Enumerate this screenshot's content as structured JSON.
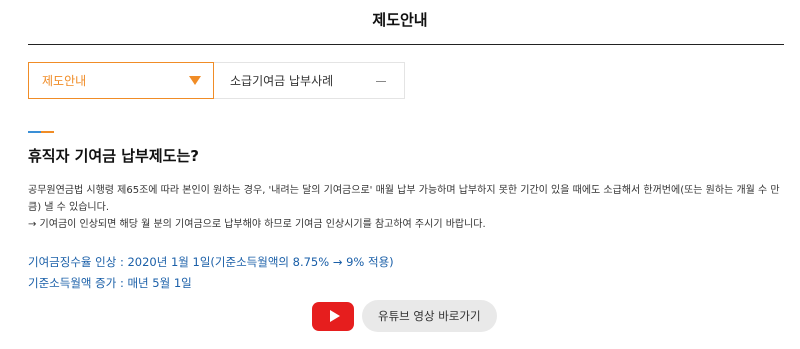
{
  "page": {
    "title": "제도안내"
  },
  "menu": {
    "dropdown_label": "제도안내",
    "tab_label": "소급기여금 납부사례"
  },
  "section": {
    "heading": "휴직자 기여금 납부제도는?",
    "paragraph1": "공무원연금법 시행령 제65조에 따라 본인이 원하는 경우, '내려는 달의 기여금으로' 매월 납부 가능하며 납부하지 못한 기간이 있을 때에도 소급해서 한꺼번에(또는 원하는 개월 수 만큼) 낼 수 있습니다.",
    "paragraph2": "→ 기여금이 인상되면 해당 월 분의 기여금으로 납부해야 하므로 기여금 인상시기를 참고하여 주시기 바랍니다.",
    "highlight1": "기여금징수율 인상 : 2020년 1월 1일(기준소득월액의 8.75% → 9% 적용)",
    "highlight2": "기준소득월액 증가 : 매년 5월 1일"
  },
  "youtube": {
    "button_label": "유튜브 영상 바로가기"
  },
  "colors": {
    "accent_orange": "#f08c26",
    "link_blue": "#1a5fa8",
    "youtube_red": "#e61e1e"
  }
}
